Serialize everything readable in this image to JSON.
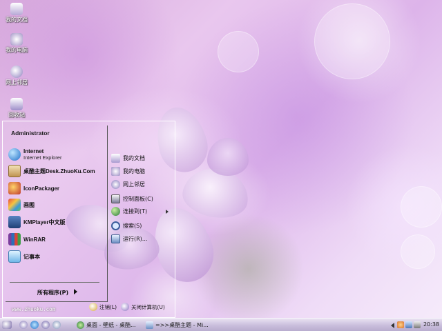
{
  "desktop": {
    "icons": [
      {
        "label": "我的文档",
        "icon": "my-documents-icon"
      },
      {
        "label": "我的电脑",
        "icon": "my-computer-icon"
      },
      {
        "label": "网上邻居",
        "icon": "network-places-icon"
      },
      {
        "label": "回收站",
        "icon": "recycle-bin-icon"
      }
    ]
  },
  "start_menu": {
    "user": "Administrator",
    "pinned": [
      {
        "title": "Internet",
        "subtitle": "Internet Explorer",
        "icon": "internet-explorer-icon"
      },
      {
        "title": "桌酷主题Desk.ZhuoKu.Com",
        "icon": "zhuoku-theme-icon"
      },
      {
        "title": "IconPackager",
        "icon": "iconpackager-icon"
      },
      {
        "title": "画图",
        "icon": "paint-icon"
      },
      {
        "title": "KMPlayer中文版",
        "icon": "kmplayer-icon"
      },
      {
        "title": "WinRAR",
        "icon": "winrar-icon"
      },
      {
        "title": "记事本",
        "icon": "notepad-icon"
      }
    ],
    "all_programs": "所有程序(P)",
    "right_items": [
      {
        "label": "我的文档",
        "icon": "my-documents-icon"
      },
      {
        "label": "我的电脑",
        "icon": "my-computer-icon"
      },
      {
        "label": "网上邻居",
        "icon": "network-places-icon"
      },
      {
        "label": "控制面板(C)",
        "icon": "control-panel-icon"
      },
      {
        "label": "连接到(T)",
        "icon": "connect-to-icon"
      },
      {
        "label": "搜索(S)",
        "icon": "search-icon"
      },
      {
        "label": "运行(R)...",
        "icon": "run-icon"
      }
    ],
    "footer_url": "www.zhuoku.com",
    "logoff": "注销(L)",
    "shutdown": "关闭计算机(U)"
  },
  "taskbar": {
    "tasks": [
      {
        "label": "桌面 - 壁纸 - 桌酷...",
        "icon": "browser-icon"
      },
      {
        "label": "=>>桌酷主题 - Mi...",
        "icon": "window-icon"
      }
    ],
    "clock": "20:38"
  }
}
